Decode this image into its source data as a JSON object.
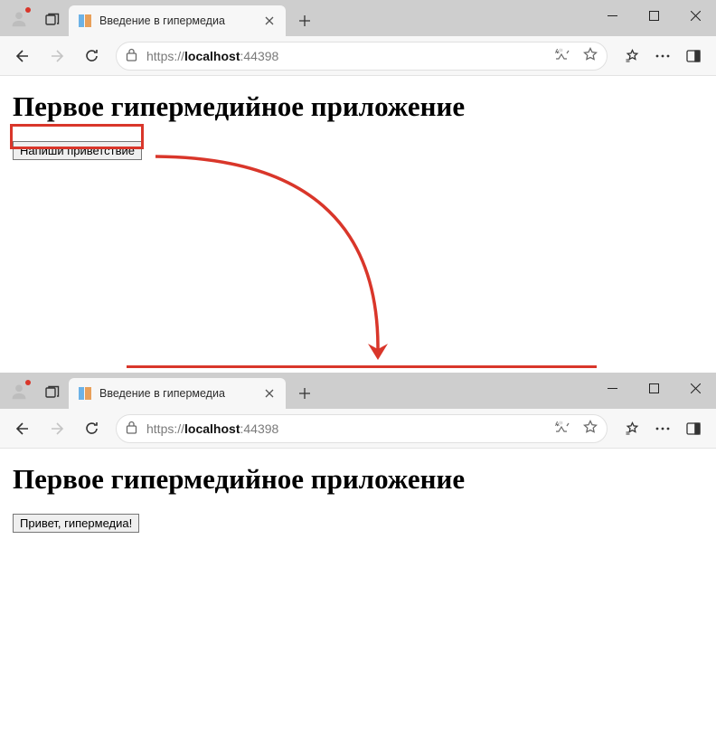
{
  "colors": {
    "annotation_red": "#d9362a"
  },
  "window_top": {
    "tab": {
      "title": "Введение в гипермедиа"
    },
    "url": {
      "scheme_host": "https://",
      "domain": "localhost",
      "port": ":44398"
    },
    "page": {
      "heading": "Первое гипермедийное приложение",
      "button_label": "Напиши приветствие"
    }
  },
  "window_bottom": {
    "tab": {
      "title": "Введение в гипермедиа"
    },
    "url": {
      "scheme_host": "https://",
      "domain": "localhost",
      "port": ":44398"
    },
    "page": {
      "heading": "Первое гипермедийное приложение",
      "button_label": "Привет, гипермедиа!"
    }
  }
}
